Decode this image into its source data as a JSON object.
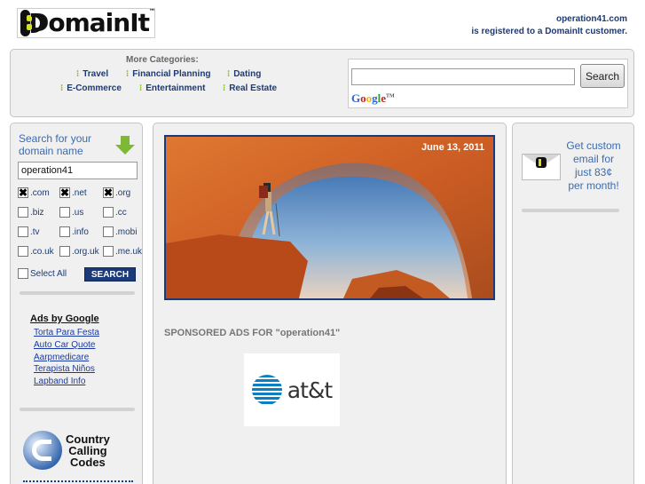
{
  "header": {
    "logo_text": "DomainIt",
    "logo_tm": "™",
    "registered_domain": "operation41.com",
    "registered_note": "is registered to a DomainIt customer."
  },
  "categories": {
    "title": "More Categories:",
    "items": [
      {
        "label": "Travel"
      },
      {
        "label": "Financial Planning"
      },
      {
        "label": "Dating"
      },
      {
        "label": "E-Commerce"
      },
      {
        "label": "Entertainment"
      },
      {
        "label": "Real Estate"
      }
    ]
  },
  "search": {
    "input_value": "",
    "button_label": "Search",
    "provider_label": "Google"
  },
  "domain_search": {
    "title_line1": "Search for your",
    "title_line2": "domain name",
    "input_value": "operation41",
    "tlds": [
      {
        "label": ".com",
        "checked": true
      },
      {
        "label": ".net",
        "checked": true
      },
      {
        "label": ".org",
        "checked": true
      },
      {
        "label": ".biz",
        "checked": false
      },
      {
        "label": ".us",
        "checked": false
      },
      {
        "label": ".cc",
        "checked": false
      },
      {
        "label": ".tv",
        "checked": false
      },
      {
        "label": ".info",
        "checked": false
      },
      {
        "label": ".mobi",
        "checked": false
      },
      {
        "label": ".co.uk",
        "checked": false
      },
      {
        "label": ".org.uk",
        "checked": false
      },
      {
        "label": ".me.uk",
        "checked": false
      }
    ],
    "select_all_label": "Select All",
    "search_button_label": "SEARCH"
  },
  "ads": {
    "title": "Ads by Google",
    "links": [
      "Torta Para Festa",
      "Auto Car Quote",
      "Aarpmedicare",
      "Terapista Niños",
      "Lapband Info"
    ]
  },
  "country_codes": {
    "line1": "Country",
    "line2": "Calling",
    "line3": "Codes"
  },
  "main": {
    "photo_date": "June 13, 2011",
    "sponsored_label": "SPONSORED ADS FOR \"operation41\"",
    "att_logo_text": "at&t"
  },
  "email_promo": {
    "line1": "Get custom",
    "line2": "email for",
    "line3": "just 83¢",
    "line4": "per month!"
  },
  "colors": {
    "brand_navy": "#1a3a7a",
    "link_blue": "#3a6bb0",
    "accent_green": "#7db935",
    "panel_bg": "#f0f0f0"
  }
}
